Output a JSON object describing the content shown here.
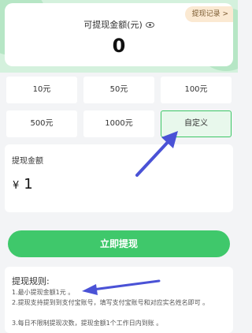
{
  "balance": {
    "label": "可提现金额(元)",
    "amount": "0",
    "record_link": "提现记录 >"
  },
  "amount_options": [
    {
      "label": "10元"
    },
    {
      "label": "50元"
    },
    {
      "label": "100元"
    },
    {
      "label": "500元"
    },
    {
      "label": "1000元"
    },
    {
      "label": "自定义",
      "selected": true
    }
  ],
  "withdraw_input": {
    "title": "提现金额",
    "currency": "¥",
    "value": "1"
  },
  "submit_label": "立即提现",
  "rules": {
    "title": "提现规则:",
    "lines": [
      "1.最小提现金额1元 。",
      "2.提现支持提到到支付宝账号，填写支付宝账号和对应实名姓名即可 。",
      "3.每日不限制提现次数，提现金额1个工作日内到账 。"
    ]
  },
  "colors": {
    "accent": "#3fc86b",
    "header_bg": "#d4f1dd",
    "selected_bg": "#e8f8ec",
    "record_bg": "#fbe9d2",
    "annotation_arrow": "#4a52d6"
  },
  "icons": [
    "eye-icon",
    "annotation-arrow"
  ]
}
